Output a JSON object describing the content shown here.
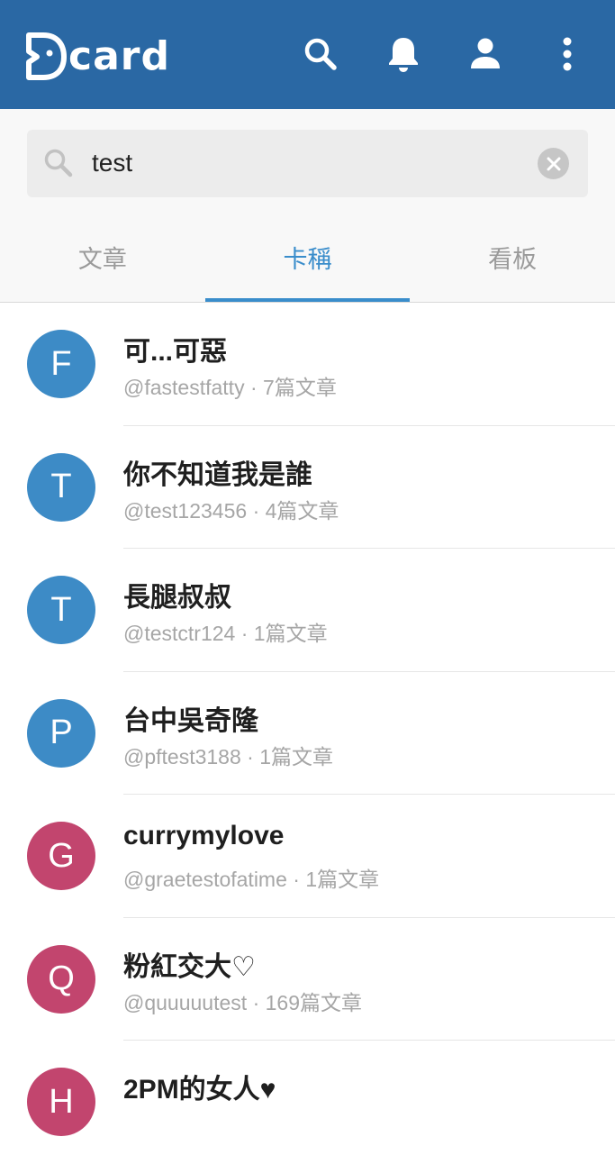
{
  "header": {
    "logo_text": "card",
    "background": "#2a68a4",
    "icons": [
      "search-icon",
      "bell-icon",
      "user-icon",
      "more-icon"
    ]
  },
  "search": {
    "value": "test",
    "placeholder": ""
  },
  "tabs": [
    {
      "label": "文章",
      "active": false
    },
    {
      "label": "卡稱",
      "active": true
    },
    {
      "label": "看板",
      "active": false
    }
  ],
  "colors": {
    "accent": "#3a8dcb",
    "avatar_blue": "#3d8bc6",
    "avatar_red": "#c2456e"
  },
  "results": [
    {
      "initial": "F",
      "name": "可...可惡",
      "handle": "@fastestfatty",
      "separator": "·",
      "count": "7篇文章",
      "avatar_color": "#3d8bc6"
    },
    {
      "initial": "T",
      "name": "你不知道我是誰",
      "handle": "@test123456",
      "separator": "·",
      "count": "4篇文章",
      "avatar_color": "#3d8bc6"
    },
    {
      "initial": "T",
      "name": "長腿叔叔",
      "handle": "@testctr124",
      "separator": "·",
      "count": "1篇文章",
      "avatar_color": "#3d8bc6"
    },
    {
      "initial": "P",
      "name": "台中吳奇隆",
      "handle": "@pftest3188",
      "separator": "·",
      "count": "1篇文章",
      "avatar_color": "#3d8bc6"
    },
    {
      "initial": "G",
      "name": "currymylove",
      "handle": "@graetestofatime",
      "separator": "·",
      "count": "1篇文章",
      "avatar_color": "#c2456e"
    },
    {
      "initial": "Q",
      "name": "粉紅交大♡",
      "handle": "@quuuuutest",
      "separator": "·",
      "count": "169篇文章",
      "avatar_color": "#c2456e"
    },
    {
      "initial": "H",
      "name": "2PM的女人♥",
      "handle": "",
      "separator": "",
      "count": "",
      "avatar_color": "#c2456e"
    }
  ]
}
